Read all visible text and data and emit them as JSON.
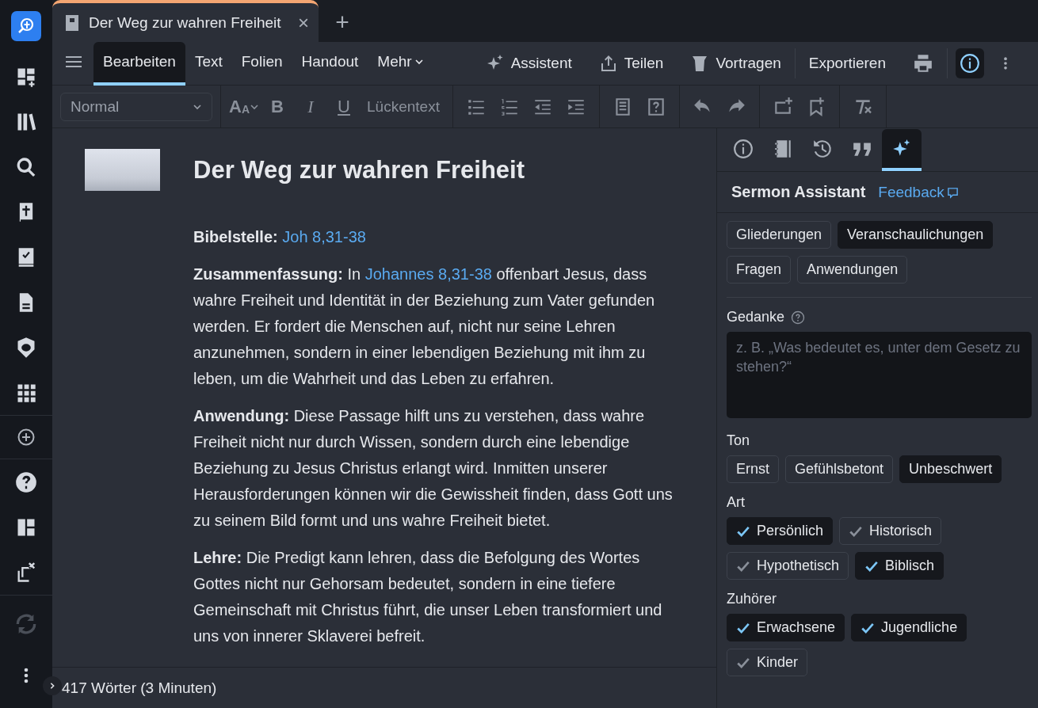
{
  "tab": {
    "title": "Der Weg zur wahren Freiheit",
    "close": "×",
    "new_tab": "+"
  },
  "menu": {
    "tabs": [
      {
        "label": "Bearbeiten",
        "selected": true
      },
      {
        "label": "Text",
        "selected": false
      },
      {
        "label": "Folien",
        "selected": false
      },
      {
        "label": "Handout",
        "selected": false
      },
      {
        "label": "Mehr",
        "selected": false
      }
    ],
    "actions": [
      {
        "label": "Assistent",
        "kind": "sparkle"
      },
      {
        "label": "Teilen",
        "kind": "share"
      },
      {
        "label": "Vortragen",
        "kind": "podium"
      }
    ],
    "export": "Exportieren",
    "info_selected": true
  },
  "format_toolbar": {
    "style_select": "Normal",
    "font_size": [
      "A",
      "A"
    ],
    "bold": "B",
    "italic": "I",
    "underline": "U",
    "cloze": "Lückentext"
  },
  "document": {
    "title": "Der Weg zur wahren Freiheit",
    "paragraphs": [
      {
        "label": "Bibelstelle:",
        "parts": [
          {
            "kind": "link",
            "text": "Joh 8,31-38"
          }
        ]
      },
      {
        "label": "Zusammenfassung:",
        "parts": [
          {
            "kind": "plain",
            "text": "In "
          },
          {
            "kind": "link",
            "text": "Johannes 8,31-38"
          },
          {
            "kind": "plain",
            "text": " offenbart Jesus, dass wahre Freiheit und Identität in der Beziehung zum Vater gefunden werden. Er fordert die Menschen auf, nicht nur seine Lehren anzunehmen, sondern in einer lebendigen Beziehung mit ihm zu leben, um die Wahrheit und das Leben zu erfahren."
          }
        ]
      },
      {
        "label": "Anwendung:",
        "parts": [
          {
            "kind": "plain",
            "text": "Diese Passage hilft uns zu verstehen, dass wahre Freiheit nicht nur durch Wissen, sondern durch eine lebendige Beziehung zu Jesus Christus erlangt wird. Inmitten unserer Herausforderungen können wir die Gewissheit finden, dass Gott uns zu seinem Bild formt und uns wahre Freiheit bietet."
          }
        ]
      },
      {
        "label": "Lehre:",
        "parts": [
          {
            "kind": "plain",
            "text": "Die Predigt kann lehren, dass die Befolgung des Wortes Gottes nicht nur Gehorsam bedeutet, sondern in eine tiefere Gemeinschaft mit Christus führt, die unser Leben transformiert und uns von innerer Sklaverei befreit."
          }
        ]
      }
    ]
  },
  "status_bar": "417 Wörter (3 Minuten)",
  "panel": {
    "tabs": [
      {
        "kind": "info",
        "selected": false
      },
      {
        "kind": "notebook",
        "selected": false
      },
      {
        "kind": "history",
        "selected": false
      },
      {
        "kind": "quote",
        "selected": false
      },
      {
        "kind": "sparkle",
        "selected": true
      }
    ],
    "title": "Sermon Assistant",
    "feedback": "Feedback",
    "categories": [
      {
        "label": "Gliederungen",
        "selected": false
      },
      {
        "label": "Veranschaulichungen",
        "selected": true
      },
      {
        "label": "Fragen",
        "selected": false
      },
      {
        "label": "Anwendungen",
        "selected": false
      }
    ],
    "thought": {
      "label": "Gedanke",
      "placeholder": "z. B. „Was bedeutet es, unter dem Gesetz zu stehen?“"
    },
    "tone": {
      "label": "Ton",
      "options": [
        {
          "label": "Ernst",
          "selected": false
        },
        {
          "label": "Gefühlsbetont",
          "selected": false
        },
        {
          "label": "Unbeschwert",
          "selected": true
        }
      ]
    },
    "type": {
      "label": "Art",
      "options": [
        {
          "label": "Persönlich",
          "checked": true
        },
        {
          "label": "Historisch",
          "checked": false
        },
        {
          "label": "Hypothetisch",
          "checked": false
        },
        {
          "label": "Biblisch",
          "checked": true
        }
      ]
    },
    "audience": {
      "label": "Zuhörer",
      "options": [
        {
          "label": "Erwachsene",
          "checked": true
        },
        {
          "label": "Jugendliche",
          "checked": true
        },
        {
          "label": "Kinder",
          "checked": false
        }
      ]
    }
  }
}
